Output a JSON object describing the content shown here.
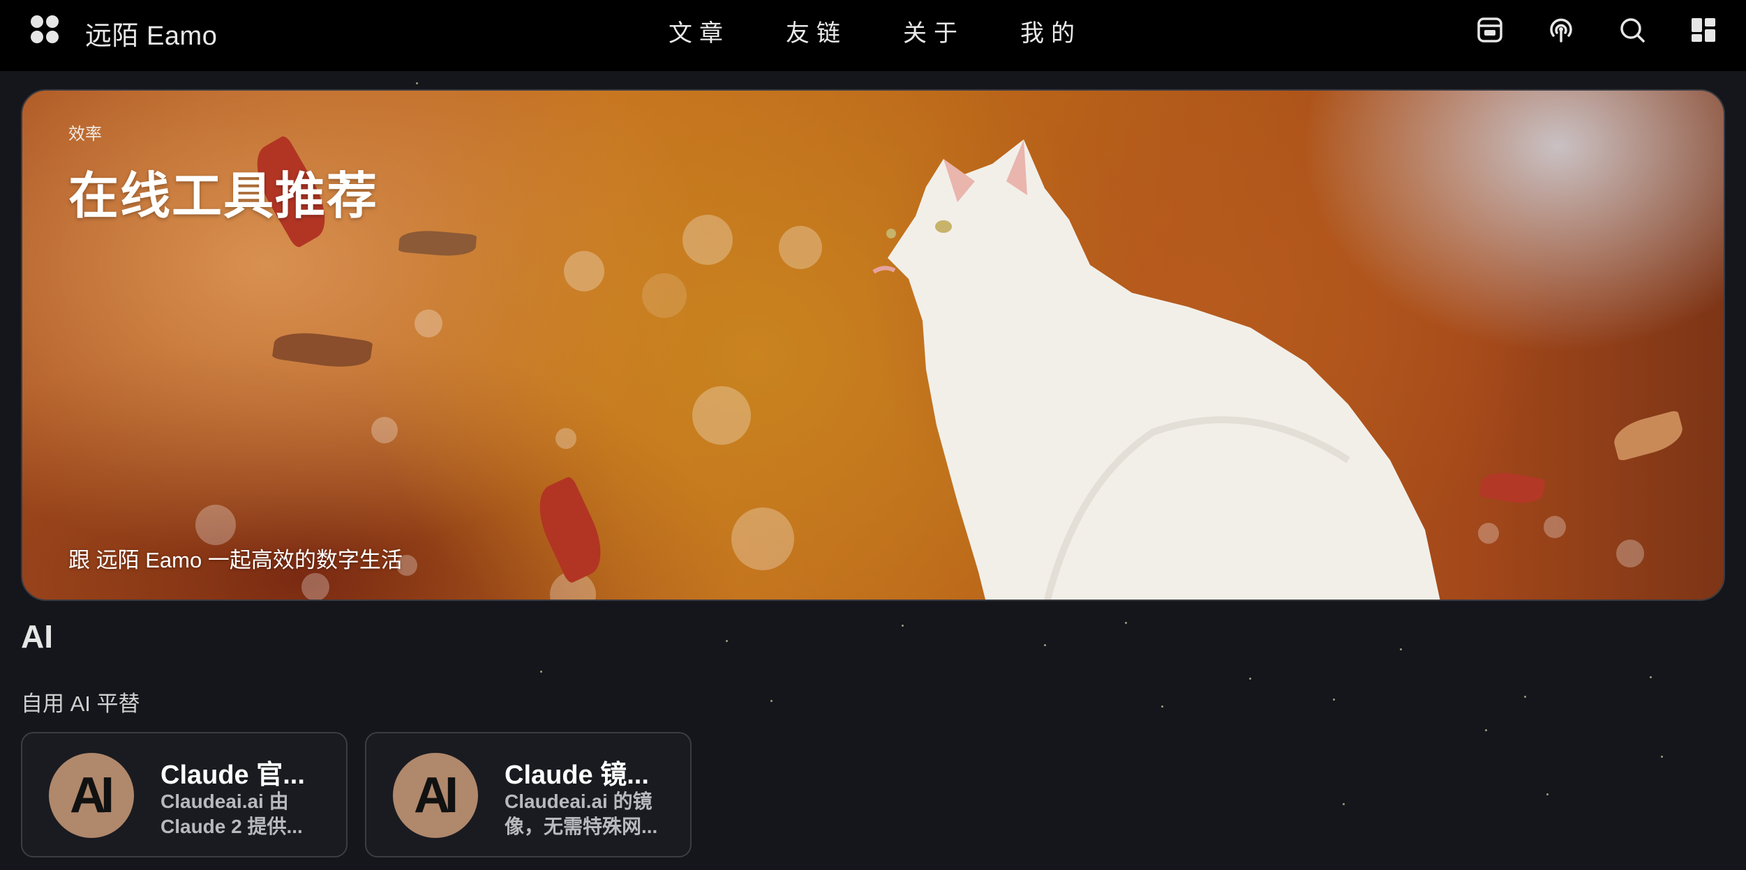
{
  "header": {
    "site_title": "远陌 Eamo",
    "nav": [
      "文章",
      "友链",
      "关于",
      "我的"
    ]
  },
  "hero": {
    "tag": "效率",
    "title": "在线工具推荐",
    "subtitle": "跟 远陌 Eamo 一起高效的数字生活"
  },
  "section": {
    "title": "AI",
    "subtitle": "自用 AI 平替"
  },
  "cards": [
    {
      "title": "Claude 官...",
      "desc": "Claudeai.ai 由 Claude 2 提供...",
      "avatar_text": "AI"
    },
    {
      "title": "Claude 镜...",
      "desc": "Claudeai.ai 的镜像，无需特殊网...",
      "avatar_text": "AI"
    }
  ],
  "icons": [
    "app-grid-icon",
    "subscribe-icon",
    "podcast-icon",
    "search-icon",
    "dashboard-icon"
  ],
  "colors": {
    "background": "#15161b",
    "nav_background": "#000000",
    "avatar": "#b0886c"
  }
}
